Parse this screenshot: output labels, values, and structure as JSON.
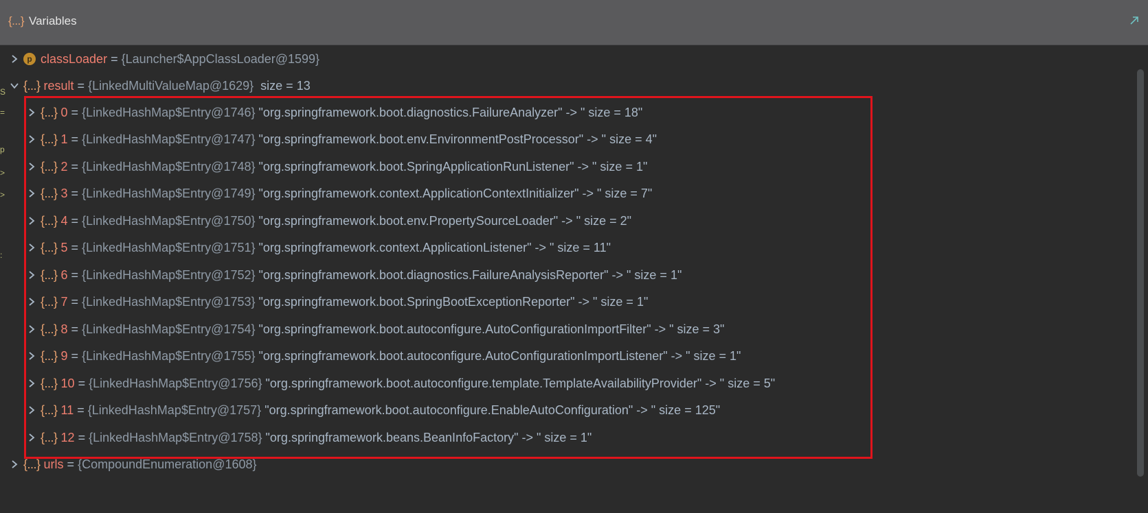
{
  "window": {
    "title": "Variables",
    "title_icon": "{...}",
    "restore_icon": "restore-icon"
  },
  "tree": {
    "class_loader": {
      "name": "classLoader",
      "eq": " = ",
      "type": "{Launcher$AppClassLoader@1599}",
      "icon": "p"
    },
    "result": {
      "name": "result",
      "eq": " = ",
      "type": "{LinkedMultiValueMap@1629}",
      "size": "  size = 13",
      "icon": "{...}"
    },
    "entries": [
      {
        "index": "0",
        "type": "{LinkedHashMap$Entry@1746}",
        "value": " \"org.springframework.boot.diagnostics.FailureAnalyzer\" -> \" size = 18\""
      },
      {
        "index": "1",
        "type": "{LinkedHashMap$Entry@1747}",
        "value": " \"org.springframework.boot.env.EnvironmentPostProcessor\" -> \" size = 4\""
      },
      {
        "index": "2",
        "type": "{LinkedHashMap$Entry@1748}",
        "value": " \"org.springframework.boot.SpringApplicationRunListener\" -> \" size = 1\""
      },
      {
        "index": "3",
        "type": "{LinkedHashMap$Entry@1749}",
        "value": " \"org.springframework.context.ApplicationContextInitializer\" -> \" size = 7\""
      },
      {
        "index": "4",
        "type": "{LinkedHashMap$Entry@1750}",
        "value": " \"org.springframework.boot.env.PropertySourceLoader\" -> \" size = 2\""
      },
      {
        "index": "5",
        "type": "{LinkedHashMap$Entry@1751}",
        "value": " \"org.springframework.context.ApplicationListener\" -> \" size = 11\""
      },
      {
        "index": "6",
        "type": "{LinkedHashMap$Entry@1752}",
        "value": " \"org.springframework.boot.diagnostics.FailureAnalysisReporter\" -> \" size = 1\""
      },
      {
        "index": "7",
        "type": "{LinkedHashMap$Entry@1753}",
        "value": " \"org.springframework.boot.SpringBootExceptionReporter\" -> \" size = 1\""
      },
      {
        "index": "8",
        "type": "{LinkedHashMap$Entry@1754}",
        "value": " \"org.springframework.boot.autoconfigure.AutoConfigurationImportFilter\" -> \" size = 3\""
      },
      {
        "index": "9",
        "type": "{LinkedHashMap$Entry@1755}",
        "value": " \"org.springframework.boot.autoconfigure.AutoConfigurationImportListener\" -> \" size = 1\""
      },
      {
        "index": "10",
        "type": "{LinkedHashMap$Entry@1756}",
        "value": " \"org.springframework.boot.autoconfigure.template.TemplateAvailabilityProvider\" -> \" size = 5\""
      },
      {
        "index": "11",
        "type": "{LinkedHashMap$Entry@1757}",
        "value": " \"org.springframework.boot.autoconfigure.EnableAutoConfiguration\" -> \" size = 125\""
      },
      {
        "index": "12",
        "type": "{LinkedHashMap$Entry@1758}",
        "value": " \"org.springframework.beans.BeanInfoFactory\" -> \" size = 1\""
      }
    ],
    "urls": {
      "name": "urls",
      "eq": " = ",
      "type": "{CompoundEnumeration@1608}",
      "icon": "{...}"
    }
  },
  "colors": {
    "titlebar": "#5a5a5c",
    "background": "#2b2b2b",
    "var_name": "#f07f70",
    "brace_icon": "#e8a270",
    "highlight_box": "#e0141c"
  }
}
